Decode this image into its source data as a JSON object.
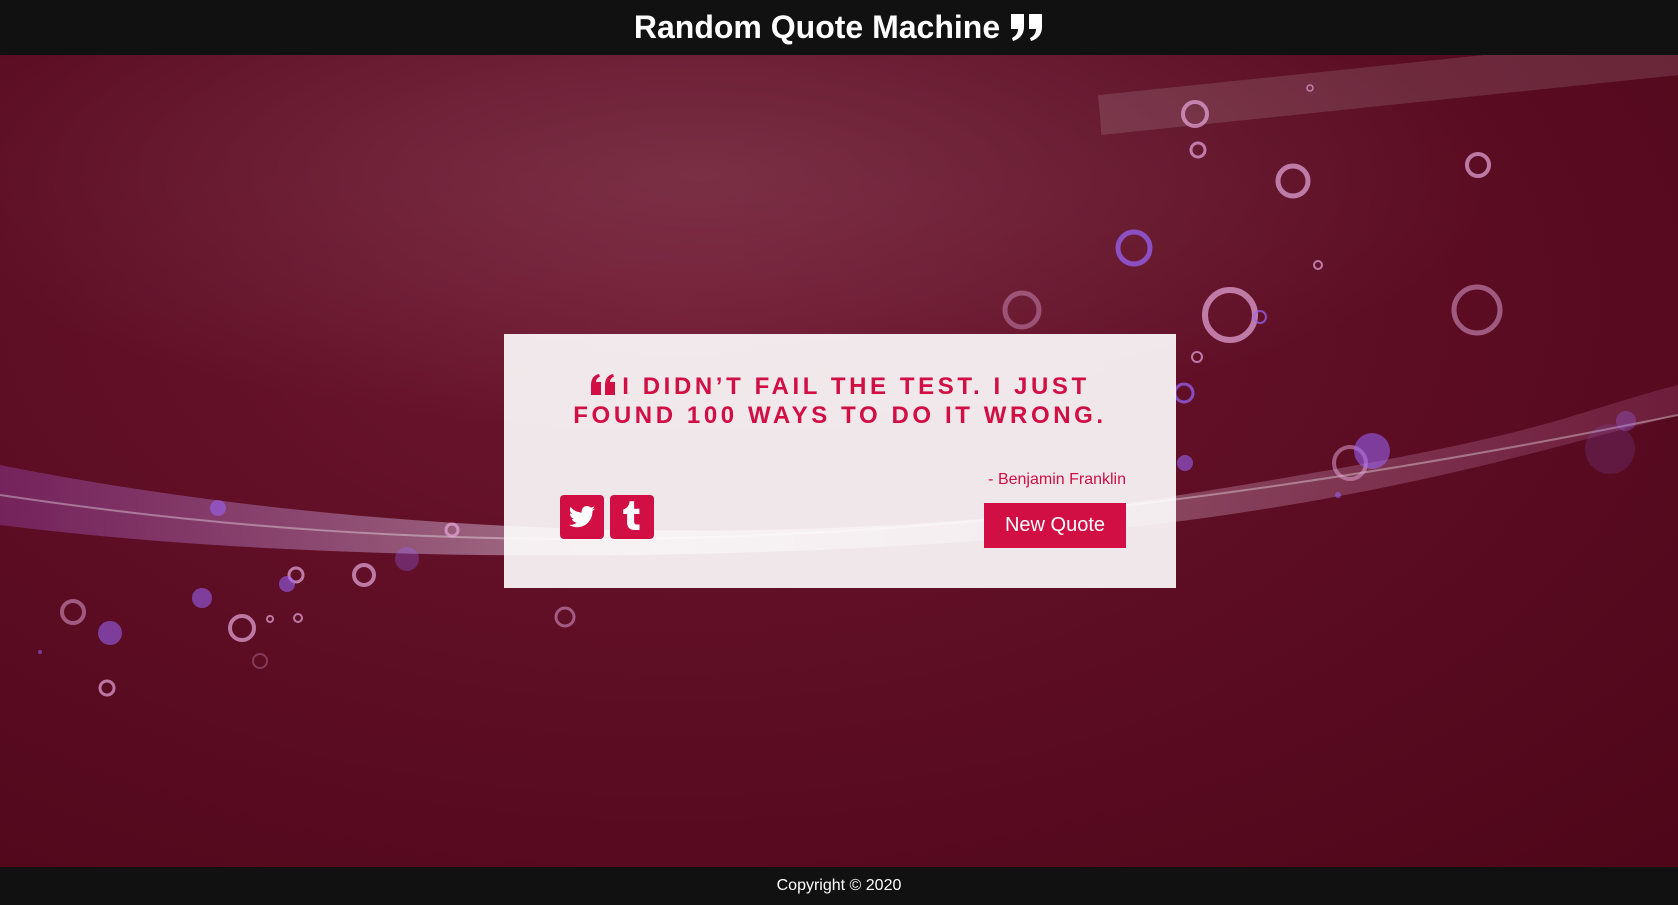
{
  "header": {
    "title": "Random Quote Machine",
    "icon": "quote-right-icon"
  },
  "quote": {
    "icon": "quote-left-icon",
    "text": "I didn’t fail the test. I just found 100 ways to do it wrong.",
    "author": "- Benjamin Franklin"
  },
  "actions": {
    "new_quote_label": "New Quote",
    "share": [
      {
        "icon": "twitter-icon"
      },
      {
        "icon": "tumblr-icon"
      }
    ]
  },
  "footer": {
    "copyright": "Copyright © 2020"
  },
  "colors": {
    "accent": "#d10f45",
    "header_bg": "#111111",
    "page_bg": "#5e0e25"
  }
}
